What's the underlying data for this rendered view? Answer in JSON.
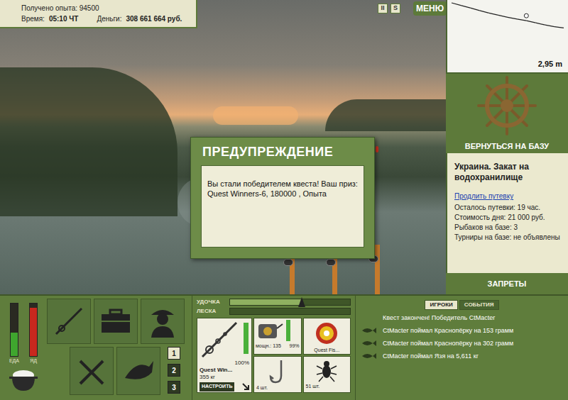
{
  "status": {
    "experience": "Получено опыта: 94500",
    "time_label": "Время:",
    "time": "05:10 ЧТ",
    "money_label": "Деньги:",
    "money": "308 661 664 руб."
  },
  "top_buttons": [
    "II",
    "S",
    "МЕНЮ"
  ],
  "depth_chart": {
    "reading": "2,95 m",
    "depths": [
      0.0,
      0.3,
      0.6,
      0.9,
      1.2,
      1.45,
      1.7,
      1.9,
      2.1,
      2.35,
      2.6,
      2.8,
      2.95
    ],
    "float_index": 8
  },
  "dialog": {
    "title": "ПРЕДУПРЕЖДЕНИЕ",
    "message": "Вы стали победителем квеста! Ваш приз: Quest Winners-6, 180000 , Опыта"
  },
  "base_panel": {
    "button": "ВЕРНУТЬСЯ НА БАЗУ",
    "location": "Украина. Закат на водохранилище",
    "extend_link": "Продлить путевку",
    "info": [
      "Осталось путевки: 19 час.",
      "Стоимость дня: 21 000 руб.",
      "Рыбаков на базе: 3",
      "Турниры на базе: не объявлены"
    ],
    "bans_button": "ЗАПРЕТЫ"
  },
  "meters": [
    {
      "label": "ЕДА",
      "level": 0.45,
      "color": "#3fa62e"
    },
    {
      "label": "ЯД",
      "level": 0.92,
      "color": "#c8281e"
    }
  ],
  "rod_tabs": [
    {
      "label": "1",
      "selected": true
    },
    {
      "label": "2",
      "selected": false
    },
    {
      "label": "3",
      "selected": false
    }
  ],
  "tackle_bars": [
    {
      "label": "УДОЧКА",
      "level": 0.6
    },
    {
      "label": "ЛЕСКА",
      "level": 0
    }
  ],
  "slots": {
    "rod": {
      "condition": "100%",
      "level": 1.0,
      "name": "Quest Win...",
      "capacity": "355 кг",
      "button": "НАСТРОИТЬ"
    },
    "reel": {
      "power": "мощн.: 135",
      "condition": "99%",
      "level": 0.99
    },
    "line": {
      "name": "Quest Fis..."
    },
    "hook": {
      "count": "4 шт."
    },
    "bait": {
      "count": "51 шт."
    }
  },
  "events": {
    "tabs": [
      {
        "label": "ИГРОКИ",
        "selected": true
      },
      {
        "label": "СОБЫТИЯ",
        "selected": false
      }
    ],
    "messages": [
      {
        "kind": "system",
        "text": "Квест закончен! Победитель CtMacter"
      },
      {
        "kind": "catch",
        "text": "CtMacter поймал Краснопёрку на 153 грамм"
      },
      {
        "kind": "catch",
        "text": "CtMacter поймал Краснопёрку на 302 грамм"
      },
      {
        "kind": "catch",
        "text": "CtMacter поймал Язя на 5,611 кг"
      }
    ]
  }
}
